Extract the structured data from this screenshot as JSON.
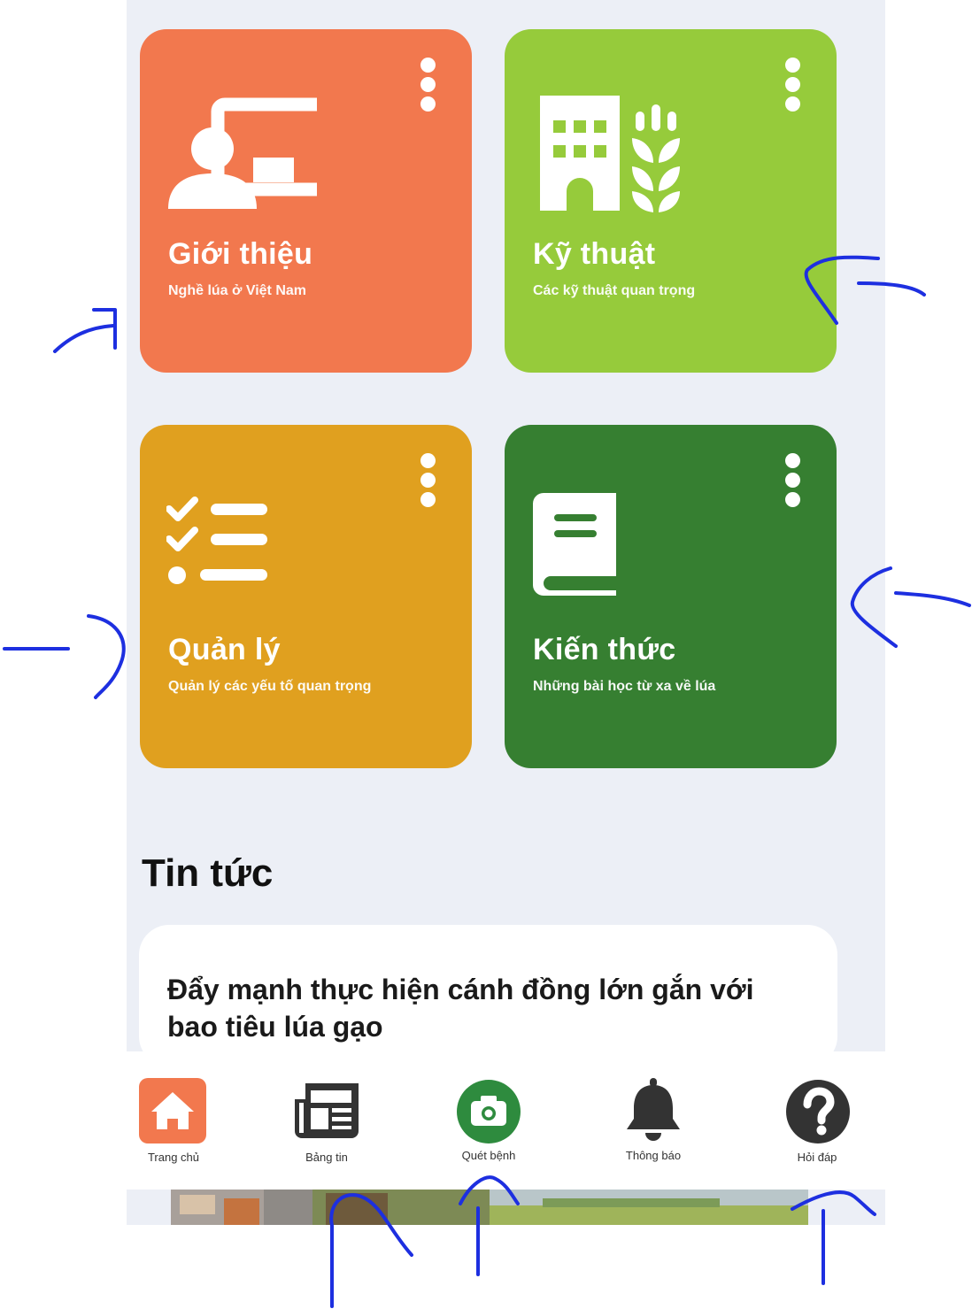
{
  "tiles": [
    {
      "title": "Giới thiệu",
      "subtitle": "Nghề lúa ở Việt Nam",
      "color": "#f2784e",
      "icon": "presentation-icon"
    },
    {
      "title": "Kỹ thuật",
      "subtitle": "Các kỹ thuật quan trọng",
      "color": "#96cb3b",
      "icon": "farm-building-icon"
    },
    {
      "title": "Quản lý",
      "subtitle": "Quản lý các yếu tố quan trọng",
      "color": "#e0a01f",
      "icon": "checklist-icon"
    },
    {
      "title": "Kiến thức",
      "subtitle": "Những bài học từ xa về lúa",
      "color": "#367f31",
      "icon": "book-icon"
    }
  ],
  "news": {
    "section_title": "Tin tức",
    "headline": "Đẩy mạnh thực hiện cánh đồng lớn gắn với bao tiêu lúa gạo"
  },
  "nav": [
    {
      "label": "Trang chủ",
      "icon": "home-icon",
      "active": true
    },
    {
      "label": "Bảng tin",
      "icon": "newspaper-icon",
      "active": false
    },
    {
      "label": "Quét bệnh",
      "icon": "camera-icon",
      "active": false
    },
    {
      "label": "Thông báo",
      "icon": "bell-icon",
      "active": false
    },
    {
      "label": "Hỏi đáp",
      "icon": "help-icon",
      "active": false
    }
  ],
  "colors": {
    "background": "#eceff6",
    "accent_home": "#f2784e",
    "accent_scan": "#2e8b3e",
    "annotation": "#1d2fe0"
  }
}
